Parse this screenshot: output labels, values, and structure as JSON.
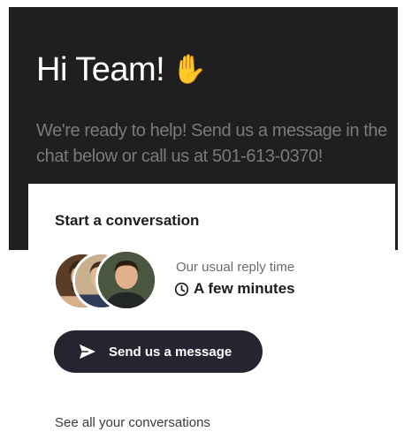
{
  "header": {
    "greeting": "Hi Team!",
    "greeting_icon": "waving-hand-icon",
    "intro_text": "We're ready to help! Send us a message in the chat below or call us at 501-613-0370!"
  },
  "card": {
    "title": "Start a conversation",
    "avatars": [
      "team-member-avatar",
      "team-member-avatar",
      "team-member-avatar"
    ],
    "reply_label": "Our usual reply time",
    "reply_icon": "clock-icon",
    "reply_value": "A few minutes",
    "send_button_label": "Send us a message",
    "send_icon": "paper-plane-icon",
    "see_all_link": "See all your conversations"
  },
  "colors": {
    "header_background": "#1f1f21",
    "button_background": "#262431",
    "wave_emoji": "#f3c229"
  }
}
